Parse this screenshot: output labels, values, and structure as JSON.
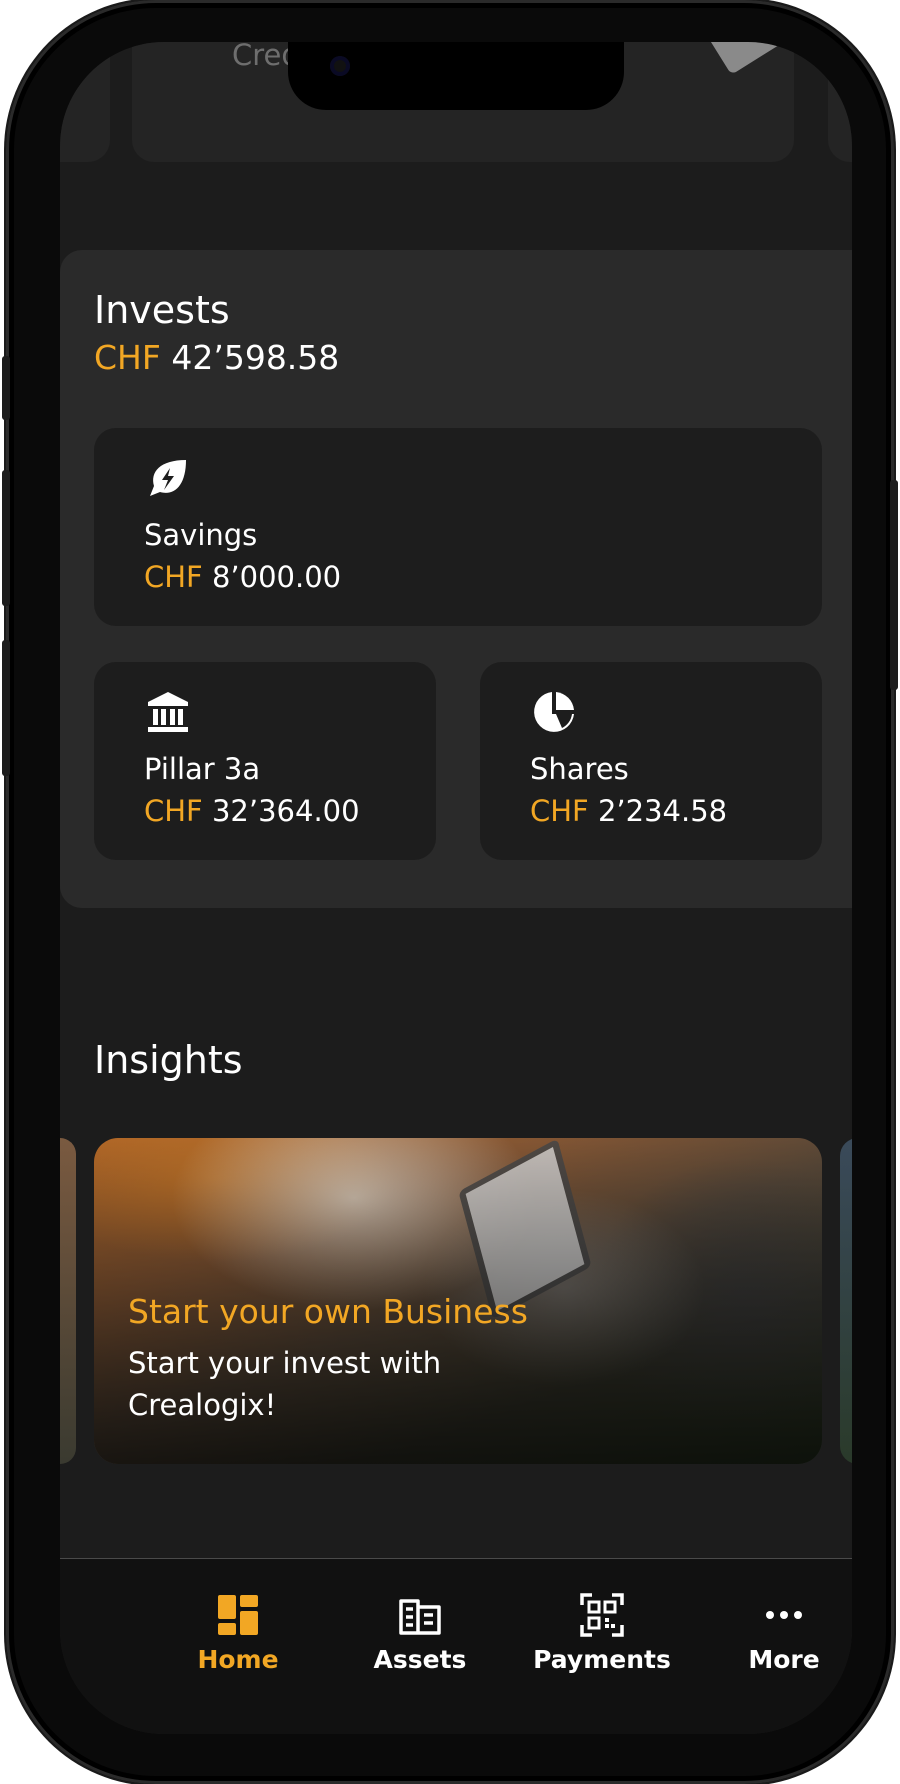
{
  "top_card": {
    "label": "Credit Ca"
  },
  "invests": {
    "title": "Invests",
    "currency": "CHF",
    "amount": "42’598.58",
    "tiles": [
      {
        "label": "Savings",
        "currency": "CHF",
        "amount": "8’000.00",
        "icon": "savings-leaf-icon"
      },
      {
        "label": "Pillar 3a",
        "currency": "CHF",
        "amount": "32’364.00",
        "icon": "bank-icon"
      },
      {
        "label": "Shares",
        "currency": "CHF",
        "amount": "2’234.58",
        "icon": "pie-chart-icon"
      }
    ]
  },
  "insights": {
    "title": "Insights",
    "card": {
      "title": "Start your own Business",
      "subtitle": "Start your invest with Crealogix!"
    }
  },
  "nav": {
    "items": [
      {
        "label": "Home",
        "icon": "home-grid-icon",
        "active": true
      },
      {
        "label": "Assets",
        "icon": "assets-icon",
        "active": false
      },
      {
        "label": "Payments",
        "icon": "qr-code-icon",
        "active": false
      },
      {
        "label": "More",
        "icon": "more-dots-icon",
        "active": false
      }
    ]
  },
  "colors": {
    "accent": "#f2a724",
    "background": "#1c1c1c",
    "panel": "#2a2a2a",
    "tile": "#1d1d1d",
    "nav_bg": "#111111"
  }
}
